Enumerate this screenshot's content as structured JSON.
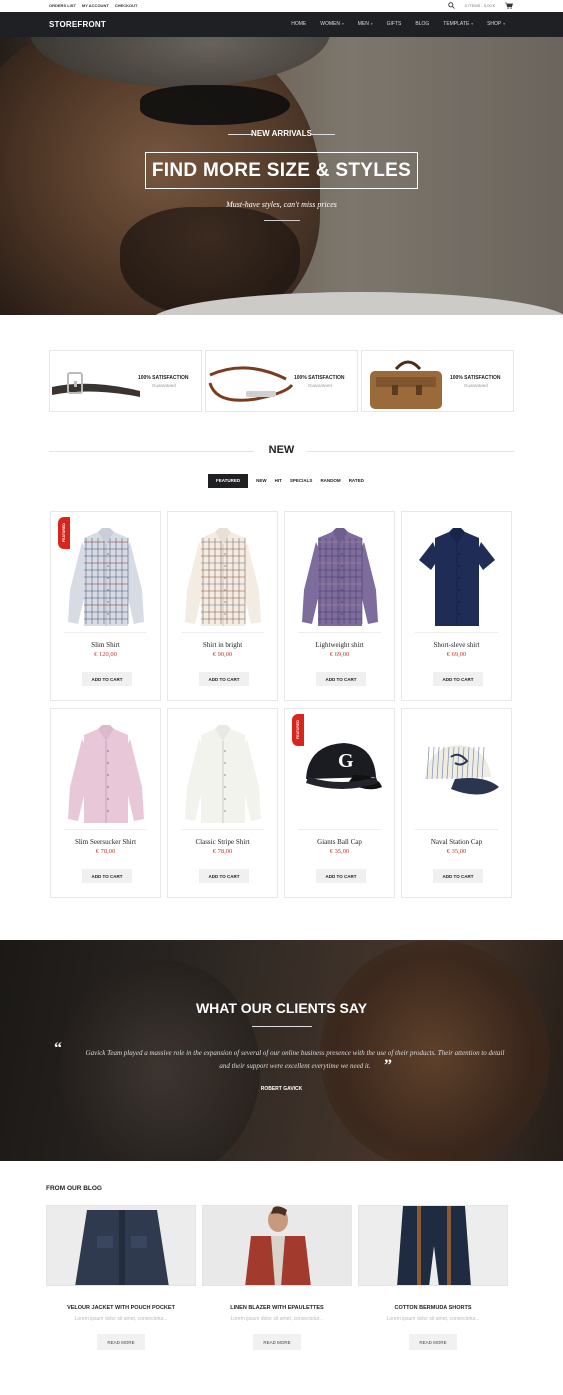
{
  "topbar": {
    "links": [
      "ORDERS LIST",
      "MY ACCOUNT",
      "CHECKOUT"
    ],
    "cart_summary": "0 ITEMS - 0,00 €"
  },
  "nav": {
    "logo": "STOREFRONT",
    "items": [
      {
        "label": "HOME",
        "dropdown": false
      },
      {
        "label": "WOMEN",
        "dropdown": true
      },
      {
        "label": "MEN",
        "dropdown": true
      },
      {
        "label": "GIFTS",
        "dropdown": false
      },
      {
        "label": "BLOG",
        "dropdown": false
      },
      {
        "label": "TEMPLATE",
        "dropdown": true
      },
      {
        "label": "SHOP",
        "dropdown": true
      }
    ]
  },
  "hero": {
    "eyebrow": "NEW ARRIVALS",
    "title": "FIND MORE SIZE & STYLES",
    "subtitle": "Must-have styles, can't miss prices"
  },
  "features": [
    {
      "title": "100% SATISFACTION",
      "subtitle": "Guaranteed",
      "image": "belt"
    },
    {
      "title": "100% SATISFACTION",
      "subtitle": "Guaranteed",
      "image": "bracelet"
    },
    {
      "title": "100% SATISFACTION",
      "subtitle": "Guaranteed",
      "image": "bag"
    }
  ],
  "new_section": {
    "heading": "NEW",
    "tabs": [
      "FEATURED",
      "NEW",
      "HIT",
      "SPECIALS",
      "RANDOM",
      "RATED"
    ],
    "active_tab": "FEATURED"
  },
  "products": [
    {
      "name": "Slim Shirt",
      "price": "€ 120,00",
      "badge": "FEATURED",
      "image": "plaid-shirt-blue",
      "cart_label": "ADD TO CART"
    },
    {
      "name": "Shirt in bright",
      "price": "€ 90,00",
      "badge": "",
      "image": "check-shirt-beige",
      "cart_label": "ADD TO CART"
    },
    {
      "name": "Lightweight shirt",
      "price": "€ 69,00",
      "badge": "",
      "image": "check-shirt-purple",
      "cart_label": "ADD TO CART"
    },
    {
      "name": "Short-sleve shirt",
      "price": "€ 69,00",
      "badge": "",
      "image": "navy-short-sleeve",
      "cart_label": "ADD TO CART"
    },
    {
      "name": "Slim Seersucker Shirt",
      "price": "€ 78,00",
      "badge": "",
      "image": "pink-shirt",
      "cart_label": "ADD TO CART"
    },
    {
      "name": "Classic Stripe Shirt",
      "price": "€ 78,00",
      "badge": "",
      "image": "white-shirt",
      "cart_label": "ADD TO CART"
    },
    {
      "name": "Giants Ball Cap",
      "price": "€ 35,00",
      "badge": "FEATURED",
      "image": "black-cap",
      "cart_label": "ADD TO CART"
    },
    {
      "name": "Naval Station Cap",
      "price": "€ 35,00",
      "badge": "",
      "image": "striped-cap",
      "cart_label": "ADD TO CART"
    }
  ],
  "testimonial": {
    "title": "WHAT OUR CLIENTS SAY",
    "quote": "Gavick Team played a massive role in the expansion of several of our online business presence with the use of their products. Their attention to detail and their support were excellent everytime we need it.",
    "author": "ROBERT GAVICK"
  },
  "blog": {
    "heading": "FROM OUR BLOG",
    "posts": [
      {
        "title": "VELOUR JACKET WITH POUCH POCKET",
        "excerpt": "Lorem ipsum dolor sit amet, consectetur...",
        "more": "READ MORE",
        "image": "denim-jacket"
      },
      {
        "title": "LINEN BLAZER WITH EPAULETTES",
        "excerpt": "Lorem ipsum dolor sit amet, consectetur...",
        "more": "READ MORE",
        "image": "red-blazer"
      },
      {
        "title": "COTTON BERMUDA SHORTS",
        "excerpt": "Lorem ipsum dolor sit amet, consectetur...",
        "more": "READ MORE",
        "image": "navy-shorts"
      }
    ]
  },
  "colors": {
    "nav_bg": "#1f2024",
    "price": "#c0392b",
    "badge": "#d9261c"
  }
}
